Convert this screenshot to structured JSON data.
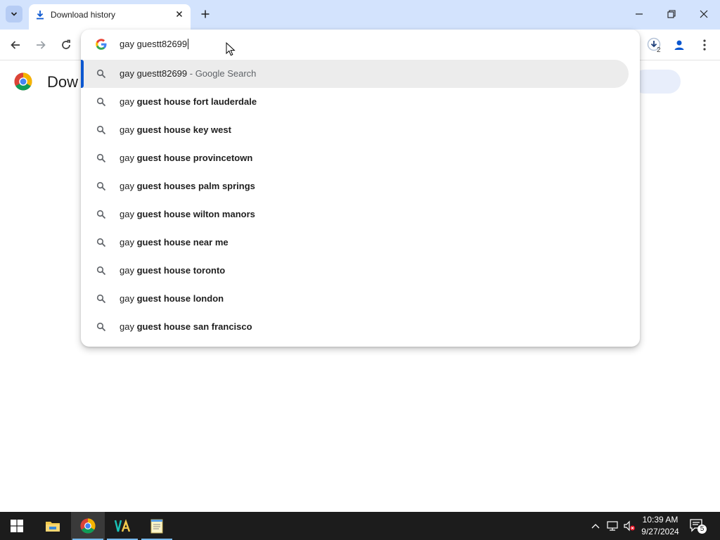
{
  "browser": {
    "tab_title": "Download history",
    "downloads_count": "2"
  },
  "page": {
    "title": "Dow"
  },
  "omnibox": {
    "input_value": "gay guestt82699",
    "suggestions": [
      {
        "prefix": "gay guestt82699",
        "bold": "",
        "suffix": " - Google Search"
      },
      {
        "prefix": "gay ",
        "bold": "guest house fort lauderdale",
        "suffix": ""
      },
      {
        "prefix": "gay ",
        "bold": "guest house key west",
        "suffix": ""
      },
      {
        "prefix": "gay ",
        "bold": "guest house provincetown",
        "suffix": ""
      },
      {
        "prefix": "gay ",
        "bold": "guest houses palm springs",
        "suffix": ""
      },
      {
        "prefix": "gay ",
        "bold": "guest house wilton manors",
        "suffix": ""
      },
      {
        "prefix": "gay ",
        "bold": "guest house near me",
        "suffix": ""
      },
      {
        "prefix": "gay ",
        "bold": "guest house toronto",
        "suffix": ""
      },
      {
        "prefix": "gay ",
        "bold": "guest house london",
        "suffix": ""
      },
      {
        "prefix": "gay ",
        "bold": "guest house san francisco",
        "suffix": ""
      }
    ]
  },
  "taskbar": {
    "time": "10:39 AM",
    "date": "9/27/2024",
    "notification_count": "5",
    "apps": [
      "windows-start-icon",
      "file-explorer-icon",
      "chrome-icon",
      "vs-app-icon",
      "notepad-icon"
    ]
  },
  "colors": {
    "tabstrip": "#d3e3fd",
    "accent": "#0b57d0",
    "taskbar": "#1c1c1c"
  }
}
